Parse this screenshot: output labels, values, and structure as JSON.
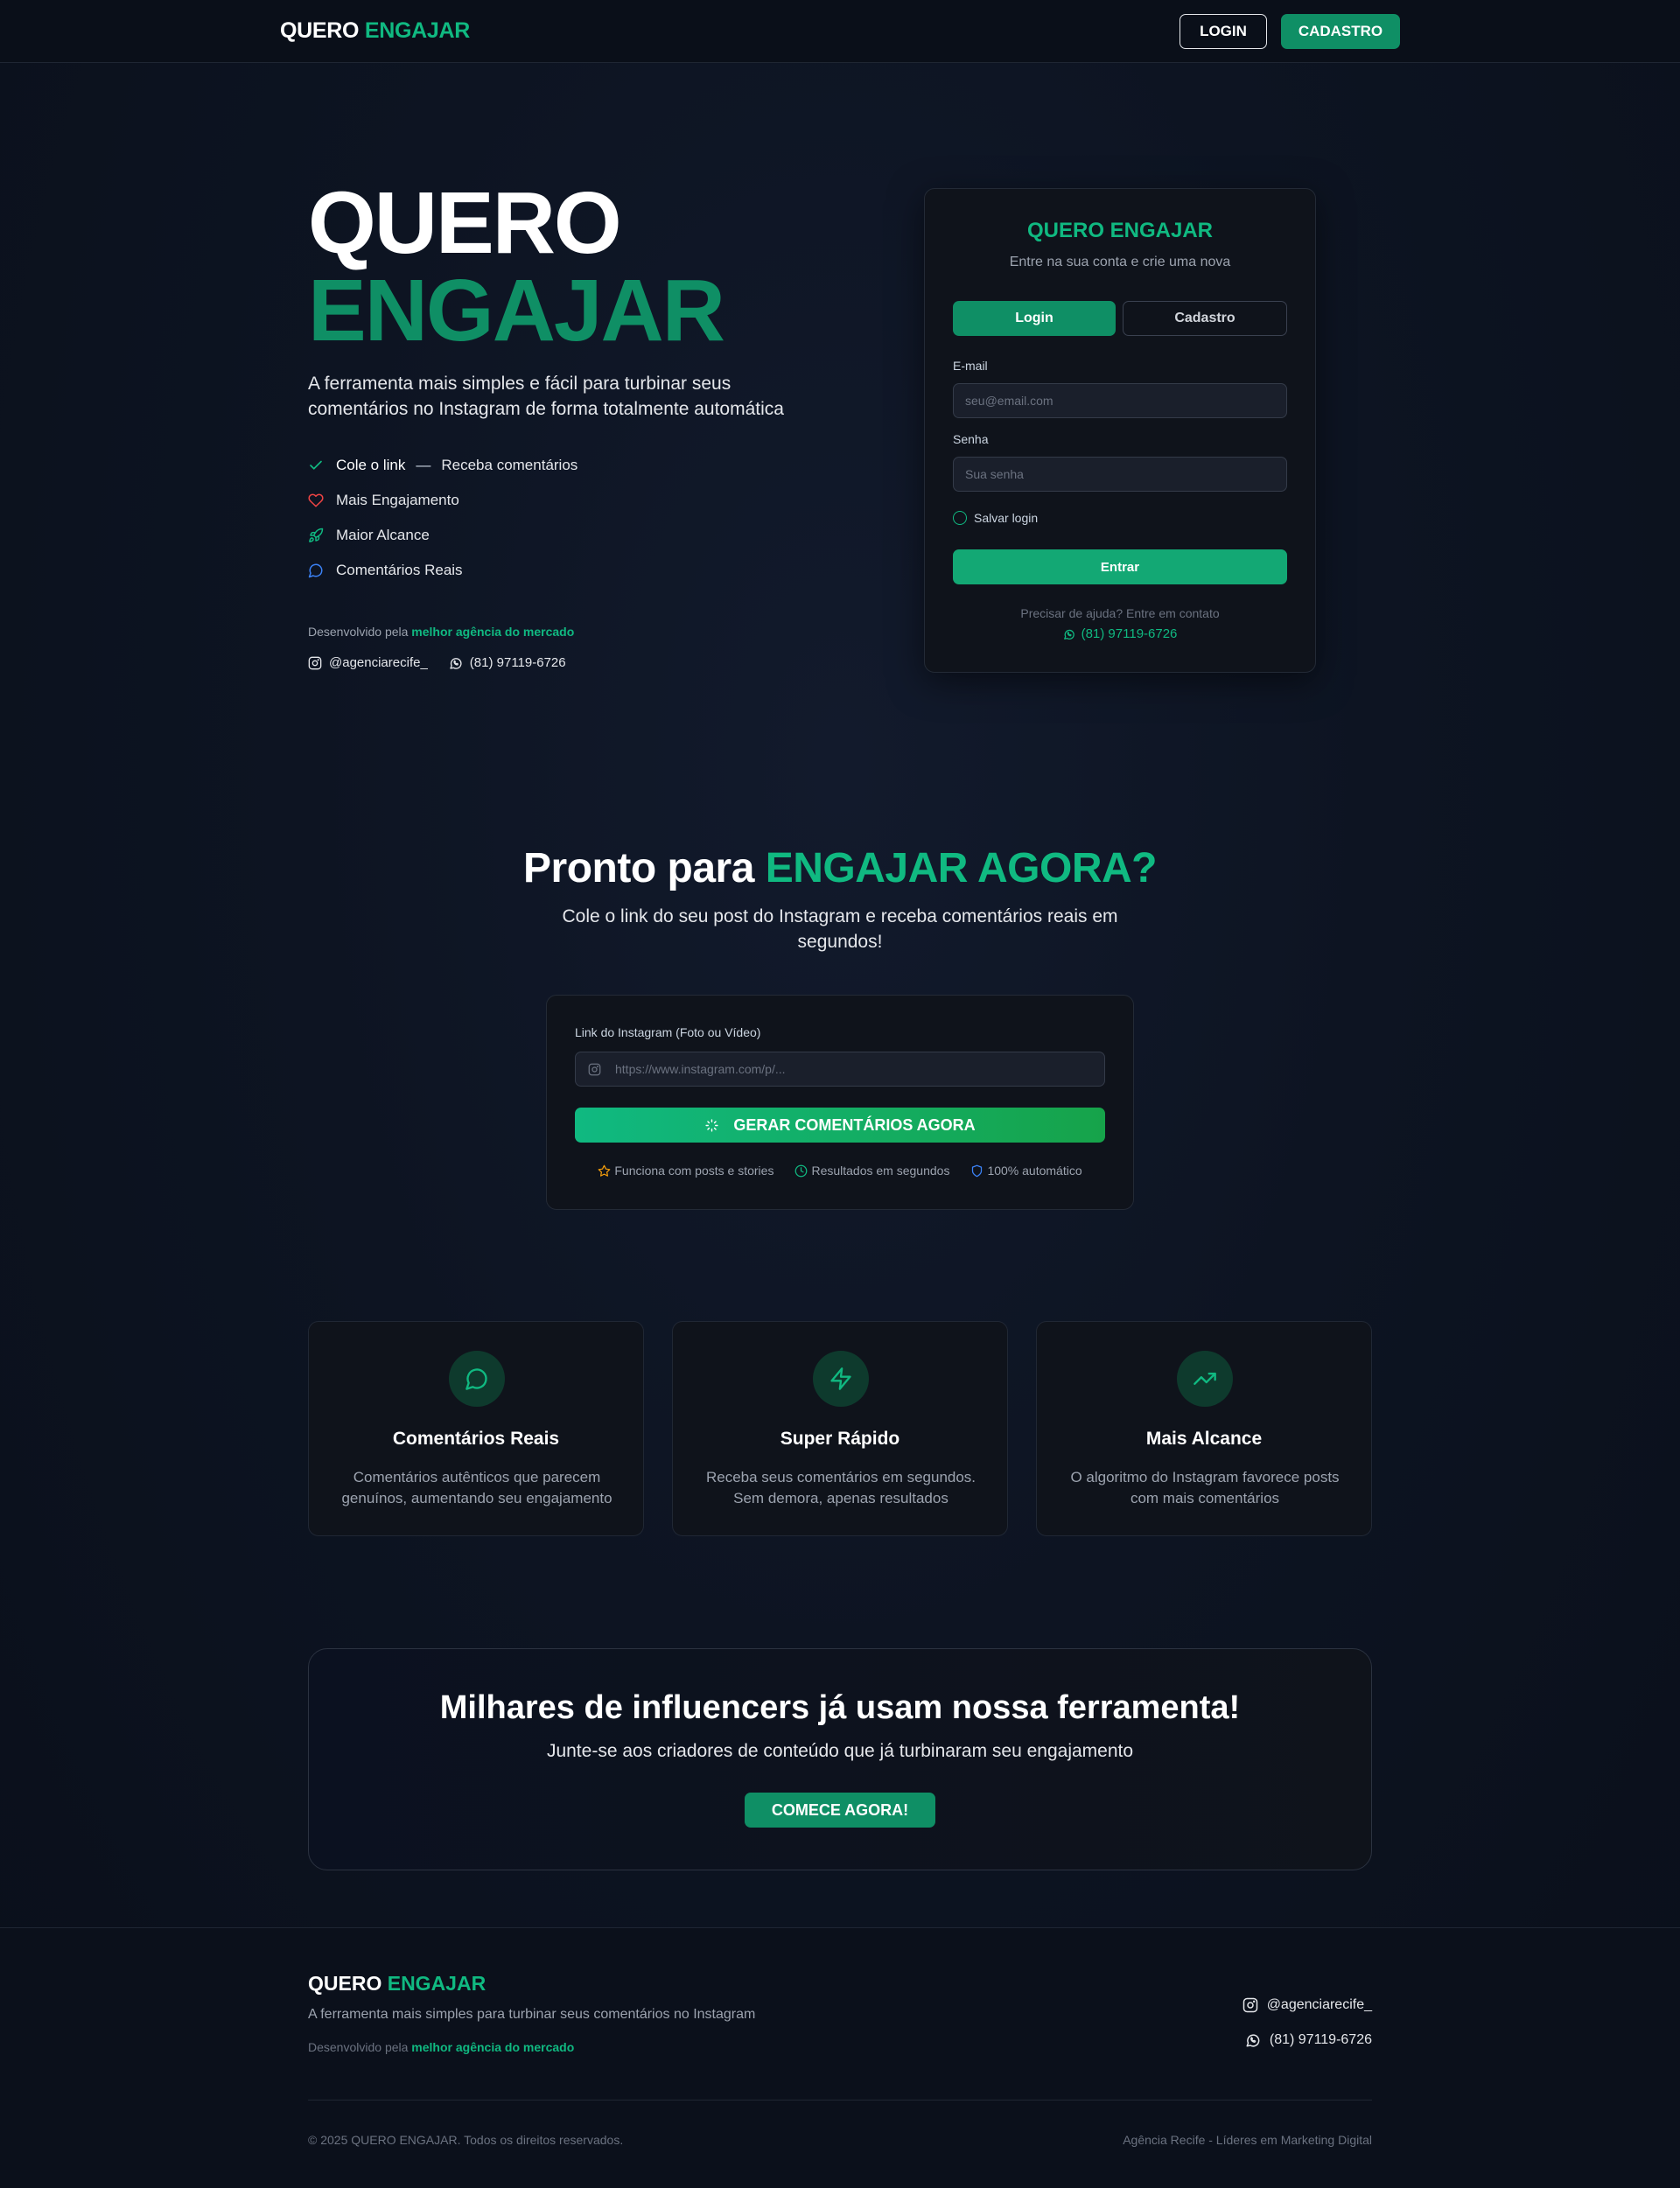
{
  "nav": {
    "logo_part1": "QUERO",
    "logo_part2": "ENGAJAR",
    "login_label": "LOGIN",
    "cadastro_label": "CADASTRO"
  },
  "hero": {
    "title_line1": "QUERO",
    "title_line2": "ENGAJAR",
    "description": "A ferramenta mais simples e fácil para turbinar seus comentários no Instagram de forma totalmente automática",
    "features": [
      {
        "icon": "check-icon",
        "label": "Cole o link",
        "dash": "—",
        "label2": "Receba comentários"
      },
      {
        "icon": "heart-icon",
        "label": "Mais Engajamento"
      },
      {
        "icon": "rocket-icon",
        "label": "Maior Alcance"
      },
      {
        "icon": "chat-bubble-icon",
        "label": "Comentários Reais"
      }
    ],
    "dev_prefix": "Desenvolvido pela",
    "dev_link": "melhor agência do mercado",
    "instagram": "@agenciarecife_",
    "phone": "(81) 97119-6726"
  },
  "login_card": {
    "title": "QUERO ENGAJAR",
    "subtitle": "Entre na sua conta e crie uma nova",
    "tab_login": "Login",
    "tab_cadastro": "Cadastro",
    "email_label": "E-mail",
    "email_placeholder": "seu@email.com",
    "password_label": "Senha",
    "password_placeholder": "Sua senha",
    "remember_label": "Salvar login",
    "submit_label": "Entrar",
    "help_text": "Precisar de ajuda? Entre em contato",
    "help_phone": "(81) 97119-6726"
  },
  "generator": {
    "title_part1": "Pronto para",
    "title_part2": "ENGAJAR AGORA?",
    "subtitle": "Cole o link do seu post do Instagram e receba comentários reais em segundos!",
    "input_label": "Link do Instagram (Foto ou Vídeo)",
    "input_placeholder": "https://www.instagram.com/p/...",
    "button_label": "GERAR COMENTÁRIOS AGORA",
    "meta": [
      {
        "icon": "star-icon",
        "label": "Funciona com posts e stories",
        "color": "#f59e0b"
      },
      {
        "icon": "clock-icon",
        "label": "Resultados em segundos",
        "color": "#10b981"
      },
      {
        "icon": "shield-icon",
        "label": "100% automático",
        "color": "#3b82f6"
      }
    ]
  },
  "features": [
    {
      "icon": "chat-bubble-icon",
      "title": "Comentários Reais",
      "description": "Comentários autênticos que parecem genuínos, aumentando seu engajamento"
    },
    {
      "icon": "lightning-icon",
      "title": "Super Rápido",
      "description": "Receba seus comentários em segundos. Sem demora, apenas resultados"
    },
    {
      "icon": "trending-up-icon",
      "title": "Mais Alcance",
      "description": "O algoritmo do Instagram favorece posts com mais comentários"
    }
  ],
  "cta": {
    "title": "Milhares de influencers já usam nossa ferramenta!",
    "subtitle": "Junte-se aos criadores de conteúdo que já turbinaram seu engajamento",
    "button_label": "COMECE AGORA!"
  },
  "footer": {
    "logo_part1": "QUERO",
    "logo_part2": "ENGAJAR",
    "description": "A ferramenta mais simples para turbinar seus comentários no Instagram",
    "dev_prefix": "Desenvolvido pela",
    "dev_link": "melhor agência do mercado",
    "instagram": "@agenciarecife_",
    "phone": "(81) 97119-6726",
    "copyright": "© 2025 QUERO ENGAJAR. Todos os direitos reservados.",
    "tagline": "Agência Recife - Líderes em Marketing Digital"
  },
  "colors": {
    "accent": "#10b981",
    "accent_dark": "#0f8f65",
    "background": "#0d1422"
  }
}
